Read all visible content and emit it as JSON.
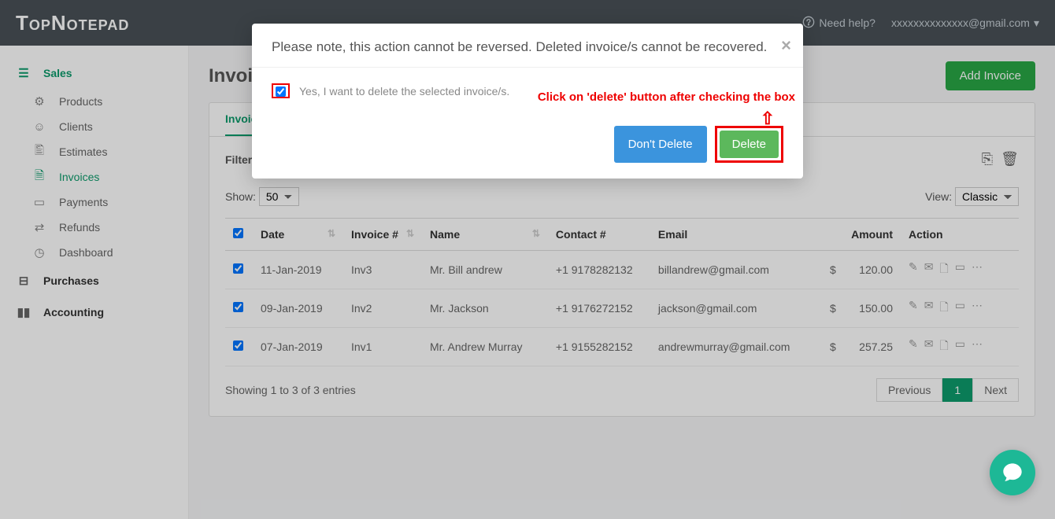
{
  "logo": "TopNotepad",
  "header": {
    "need_help": "Need help?",
    "user_email": "xxxxxxxxxxxxxx@gmail.com"
  },
  "sidebar": {
    "sales": "Sales",
    "items": [
      "Products",
      "Clients",
      "Estimates",
      "Invoices",
      "Payments",
      "Refunds",
      "Dashboard"
    ],
    "purchases": "Purchases",
    "accounting": "Accounting"
  },
  "page": {
    "title": "Invoices",
    "add_btn": "Add Invoice",
    "tab": "Invoices",
    "filter": "Filter",
    "show_label": "Show:",
    "show_value": "50",
    "view_label": "View:",
    "view_value": "Classic",
    "entries_text": "Showing 1 to 3 of 3 entries",
    "prev": "Previous",
    "page1": "1",
    "next": "Next"
  },
  "cols": {
    "date": "Date",
    "invoice": "Invoice #",
    "name": "Name",
    "contact": "Contact #",
    "email": "Email",
    "amount": "Amount",
    "action": "Action"
  },
  "rows": [
    {
      "date": "11-Jan-2019",
      "inv": "Inv3",
      "name": "Mr. Bill andrew",
      "contact": "+1 9178282132",
      "email": "billandrew@gmail.com",
      "currency": "$",
      "amount": "120.00"
    },
    {
      "date": "09-Jan-2019",
      "inv": "Inv2",
      "name": "Mr. Jackson",
      "contact": "+1 9176272152",
      "email": "jackson@gmail.com",
      "currency": "$",
      "amount": "150.00"
    },
    {
      "date": "07-Jan-2019",
      "inv": "Inv1",
      "name": "Mr. Andrew Murray",
      "contact": "+1 9155282152",
      "email": "andrewmurray@gmail.com",
      "currency": "$",
      "amount": "257.25"
    }
  ],
  "modal": {
    "msg": "Please note, this action cannot be reversed. Deleted invoice/s cannot be recovered.",
    "check_label": "Yes, I want to delete the selected invoice/s.",
    "annotation": "Click on 'delete' button after checking the box",
    "dont_delete": "Don't Delete",
    "delete": "Delete"
  }
}
